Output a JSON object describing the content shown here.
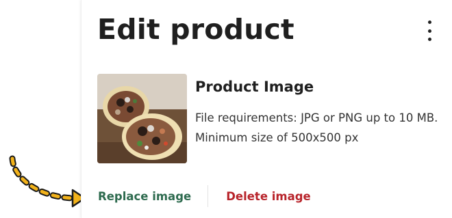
{
  "header": {
    "title": "Edit product",
    "menu_icon": "kebab-menu-icon"
  },
  "image_section": {
    "title": "Product Image",
    "requirements": "File requirements: JPG or PNG up to 10 MB. Minimum size of 500x500 px",
    "thumbnail_icon": "product-thumbnail"
  },
  "actions": {
    "replace_label": "Replace image",
    "delete_label": "Delete image"
  },
  "annotation": {
    "arrow_icon": "dashed-arrow-icon"
  },
  "colors": {
    "replace": "#2e6b4f",
    "delete": "#b8242b",
    "arrow": "#f2b21a",
    "title": "#1f1f1f"
  }
}
